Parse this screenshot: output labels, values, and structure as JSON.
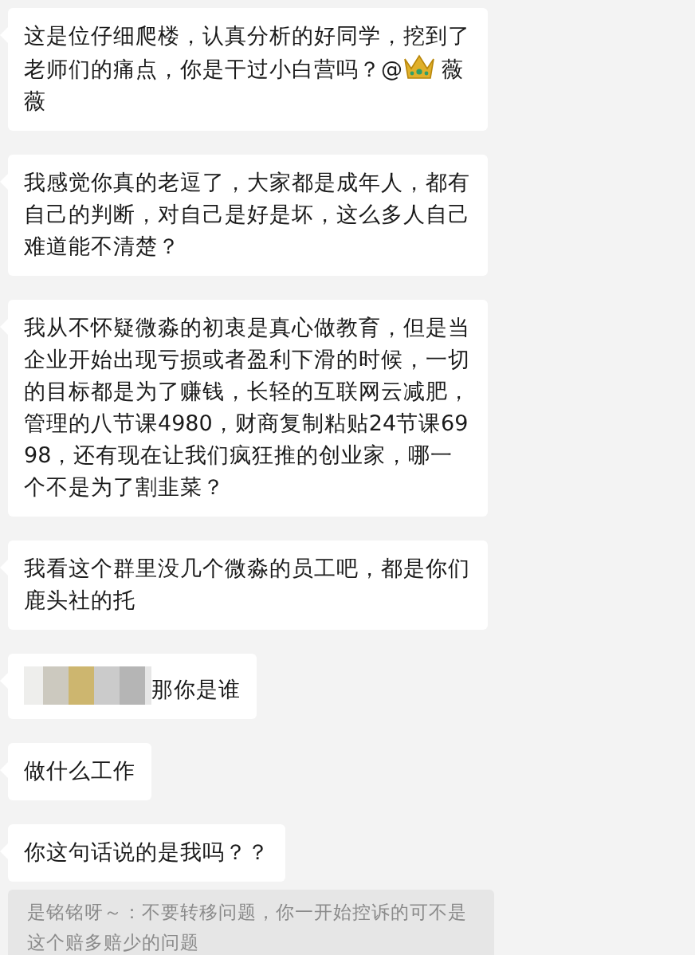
{
  "messages": [
    {
      "kind": "bubble",
      "parts": [
        {
          "kind": "text",
          "text": "这是位仔细爬楼，认真分析的好同学，挖到了老师们的痛点，你是干过小白营吗？@"
        },
        {
          "kind": "crown"
        },
        {
          "kind": "text",
          "text": " 薇薇"
        }
      ]
    },
    {
      "kind": "bubble",
      "parts": [
        {
          "kind": "text",
          "text": "我感觉你真的老逗了，大家都是成年人，都有自己的判断，对自己是好是坏，这么多人自己难道能不清楚？"
        }
      ]
    },
    {
      "kind": "bubble",
      "parts": [
        {
          "kind": "text",
          "text": "我从不怀疑微淼的初衷是真心做教育，但是当企业开始出现亏损或者盈利下滑的时候，一切的目标都是为了赚钱，长轻的互联网云减肥，管理的八节课4980，财商复制粘贴24节课6998，还有现在让我们疯狂推的创业家，哪一个不是为了割韭菜？"
        }
      ]
    },
    {
      "kind": "bubble",
      "parts": [
        {
          "kind": "text",
          "text": "我看这个群里没几个微淼的员工吧，都是你们鹿头社的托"
        }
      ]
    },
    {
      "kind": "bubble",
      "parts": [
        {
          "kind": "mosaic"
        },
        {
          "kind": "text",
          "text": "那你是谁"
        }
      ]
    },
    {
      "kind": "bubble",
      "parts": [
        {
          "kind": "text",
          "text": "做什么工作"
        }
      ]
    },
    {
      "kind": "bubble",
      "parts": [
        {
          "kind": "text",
          "text": "你这句话说的是我吗？？"
        }
      ]
    },
    {
      "kind": "quote",
      "parts": [
        {
          "kind": "text",
          "text": "是铭铭呀～：不要转移问题，你一开始控诉的可不是这个赔多赔少的问题"
        }
      ]
    }
  ]
}
